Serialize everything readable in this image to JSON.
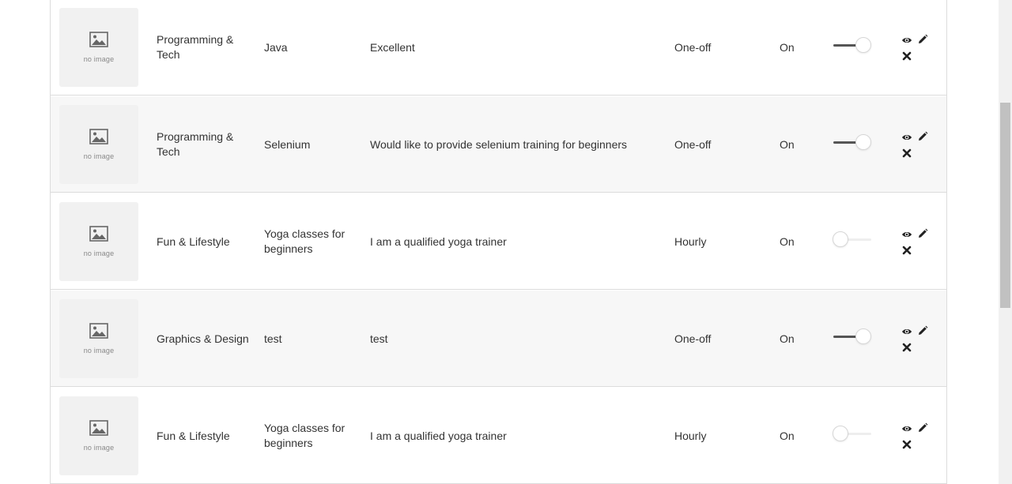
{
  "no_image_label": "no image",
  "rows": [
    {
      "category": "Programming & Tech",
      "title": "Java",
      "description": "Excellent",
      "type": "One-off",
      "status": "On",
      "toggle_on": true
    },
    {
      "category": "Programming & Tech",
      "title": "Selenium",
      "description": "Would like to provide selenium training for beginners",
      "type": "One-off",
      "status": "On",
      "toggle_on": true
    },
    {
      "category": "Fun & Lifestyle",
      "title": "Yoga classes for beginners",
      "description": "I am a qualified yoga trainer",
      "type": "Hourly",
      "status": "On",
      "toggle_on": false
    },
    {
      "category": "Graphics & Design",
      "title": "test",
      "description": "test",
      "type": "One-off",
      "status": "On",
      "toggle_on": true
    },
    {
      "category": "Fun & Lifestyle",
      "title": "Yoga classes for beginners",
      "description": "I am a qualified yoga trainer",
      "type": "Hourly",
      "status": "On",
      "toggle_on": false
    }
  ],
  "icons": {
    "thumbnail": "image-placeholder-icon",
    "view": "eye-icon",
    "edit": "pencil-icon",
    "delete": "close-icon"
  },
  "colors": {
    "row_alt_bg": "#f7f7f7",
    "border": "#dcdcdc",
    "toggle_active": "#555555",
    "icon": "#222222"
  }
}
